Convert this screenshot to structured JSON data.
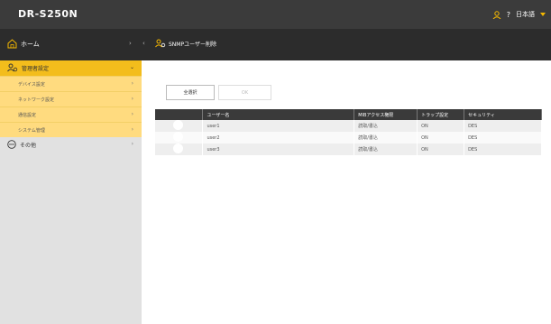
{
  "header": {
    "brand": "DR-S250N",
    "help": "?",
    "language": "日本語",
    "user_icon": "user-icon",
    "accent": "#f5b800"
  },
  "nav": {
    "home": "ホーム",
    "breadcrumb": "SNMPユーザー削除"
  },
  "sidebar": {
    "section": "管理者設定",
    "items": [
      {
        "label": "デバイス設定"
      },
      {
        "label": "ネットワーク設定"
      },
      {
        "label": "通信設定"
      },
      {
        "label": "システム管理"
      }
    ],
    "other": "その他"
  },
  "toolbar": {
    "select_all": "全選択",
    "ok": "OK"
  },
  "table": {
    "headers": [
      "ユーザー名",
      "MIBアクセス権限",
      "トラップ設定",
      "セキュリティ"
    ],
    "rows": [
      [
        "user1",
        "読取/書込",
        "ON",
        "DES"
      ],
      [
        "user2",
        "読取/書込",
        "ON",
        "DES"
      ],
      [
        "user3",
        "読取/書込",
        "ON",
        "DES"
      ]
    ]
  }
}
